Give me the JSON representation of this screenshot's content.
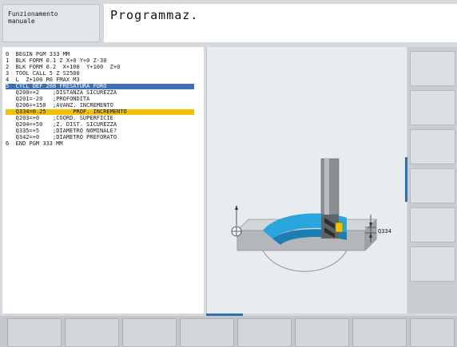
{
  "header": {
    "mode": "Funzionamento\nmanuale",
    "title": "Programmaz."
  },
  "program": {
    "lines": [
      "0  BEGIN PGM 333 MM",
      "1  BLK FORM 0.1 Z X+0 Y+0 Z-30",
      "2  BLK FORM 0.2  X+100  Y+100  Z+0",
      "3  TOOL CALL 5 Z S2500",
      "4  L  Z+100 R0 FMAX M3",
      "5  CYCL DEF 208 FRESATURA FORO",
      "   Q200=+2    ;DISTANZA SICUREZZA",
      "   Q201=-20   ;PROFONDITA",
      "   Q206=+150  ;AVANZ. INCREMENTO",
      "   Q334=0.25        PROF. INCREMENTO",
      "   Q203=+0    ;COORD. SUPERFICIE",
      "   Q204=+50   ;Z. DIST. SICUREZZA",
      "   Q335=+5    ;DIAMETRO NOMINALE?",
      "   Q342=+0    ;DIAMETRO PREFORATO",
      "6  END PGM 333 MM"
    ]
  },
  "graphic": {
    "dimension_label": "Q334",
    "colors": {
      "part": "#b3b7bb",
      "pocket": "#2aa6df",
      "tool": "#7a7f84",
      "insert": "#f2c200"
    }
  }
}
